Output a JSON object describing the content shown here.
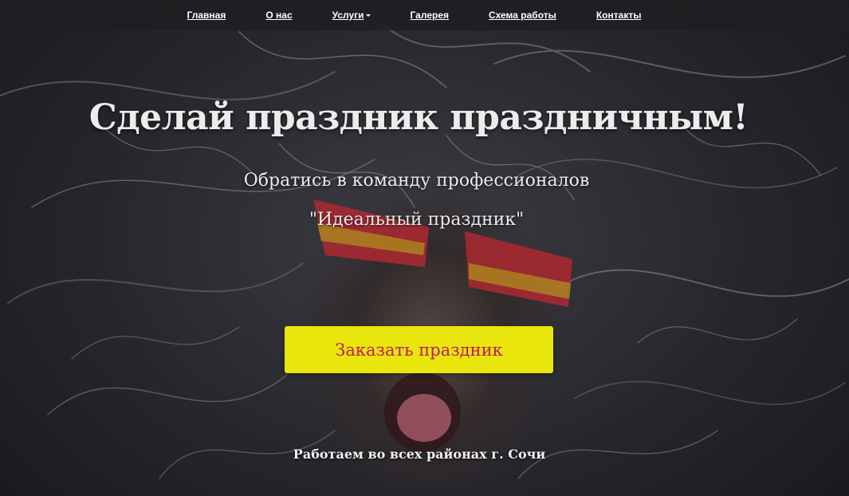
{
  "nav": {
    "items": [
      {
        "label": "Главная"
      },
      {
        "label": "О нас"
      },
      {
        "label": "Услуги",
        "has_dropdown": true
      },
      {
        "label": "Галерея"
      },
      {
        "label": "Схема работы"
      },
      {
        "label": "Контакты"
      }
    ]
  },
  "hero": {
    "title": "Сделай праздник праздничным!",
    "subtitle_line1": "Обратись в команду профессионалов",
    "subtitle_line2": "\"Идеальный праздник\"",
    "cta_label": "Заказать праздник",
    "footer_note": "Работаем во всех районах г. Сочи"
  },
  "colors": {
    "cta_background": "#e8e60c",
    "cta_text": "#c2185b",
    "navbar_background": "#1e1e22"
  }
}
